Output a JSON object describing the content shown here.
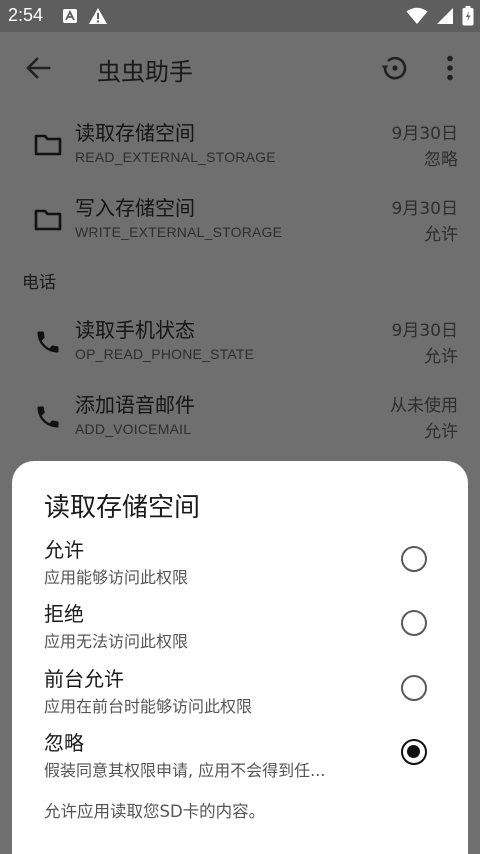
{
  "status_bar": {
    "time": "2:54"
  },
  "app_bar": {
    "title": "虫虫助手"
  },
  "permissions": [
    {
      "name": "读取存储空间",
      "code": "READ_EXTERNAL_STORAGE",
      "date": "9月30日",
      "status": "忽略",
      "icon": "folder-icon"
    },
    {
      "name": "写入存储空间",
      "code": "WRITE_EXTERNAL_STORAGE",
      "date": "9月30日",
      "status": "允许",
      "icon": "folder-icon"
    },
    {
      "name": "读取手机状态",
      "code": "OP_READ_PHONE_STATE",
      "date": "9月30日",
      "status": "允许",
      "icon": "phone-icon"
    },
    {
      "name": "添加语音邮件",
      "code": "ADD_VOICEMAIL",
      "date": "从未使用",
      "status": "允许",
      "icon": "phone-icon"
    }
  ],
  "section_phone": "电话",
  "dialog": {
    "title": "读取存储空间",
    "options": [
      {
        "title": "允许",
        "subtitle": "应用能够访问此权限",
        "checked": false
      },
      {
        "title": "拒绝",
        "subtitle": "应用无法访问此权限",
        "checked": false
      },
      {
        "title": "前台允许",
        "subtitle": "应用在前台时能够访问此权限",
        "checked": false
      },
      {
        "title": "忽略",
        "subtitle": "假装同意其权限申请, 应用不会得到任...",
        "checked": true
      }
    ],
    "description": "允许应用读取您SD卡的内容。"
  }
}
